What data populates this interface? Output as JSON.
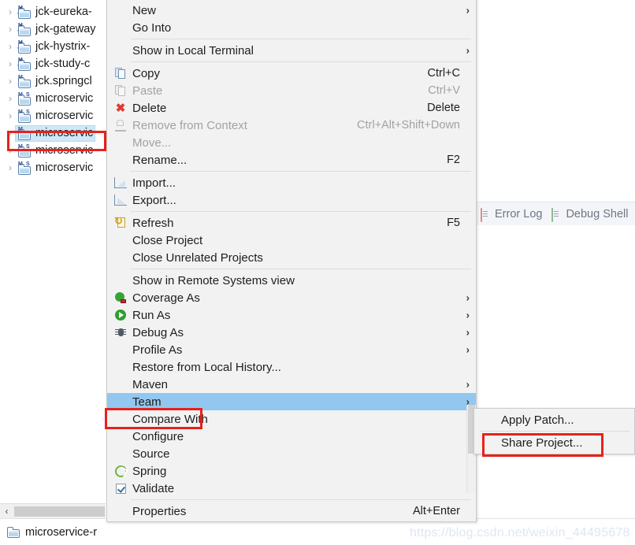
{
  "explorer": {
    "items": [
      {
        "label": "jck-eureka-",
        "badges": [
          "M",
          "J"
        ],
        "selected": false
      },
      {
        "label": "jck-gateway",
        "badges": [
          "M",
          "J"
        ],
        "selected": false
      },
      {
        "label": "jck-hystrix-",
        "badges": [
          "M",
          "J"
        ],
        "selected": false
      },
      {
        "label": "jck-study-c",
        "badges": [
          "M",
          "J"
        ],
        "selected": false
      },
      {
        "label": "jck.springcl",
        "badges": [
          "M"
        ],
        "selected": false
      },
      {
        "label": "microservic",
        "badges": [
          "M",
          "S"
        ],
        "selected": false
      },
      {
        "label": "microservic",
        "badges": [
          "M",
          "S"
        ],
        "selected": false
      },
      {
        "label": "microservic",
        "badges": [
          "M"
        ],
        "selected": true
      },
      {
        "label": "microservic",
        "badges": [
          "M",
          "S"
        ],
        "selected": false
      },
      {
        "label": "microservic",
        "badges": [
          "M",
          "S"
        ],
        "selected": false
      }
    ],
    "twisty": "›",
    "scrollbar": {
      "left_arrow": "‹"
    }
  },
  "statusbar": {
    "label": "microservice-r"
  },
  "view_tabs": [
    {
      "label": "Error Log",
      "icon": "error-log-icon"
    },
    {
      "label": "Debug Shell",
      "icon": "debug-shell-icon"
    }
  ],
  "context_menu": {
    "arrow": "›",
    "items": [
      {
        "type": "item",
        "label": "New",
        "accel": "",
        "icon": "",
        "submenu": true,
        "disabled": false
      },
      {
        "type": "item",
        "label": "Go Into",
        "accel": "",
        "icon": "",
        "submenu": false,
        "disabled": false
      },
      {
        "type": "separator"
      },
      {
        "type": "item",
        "label": "Show in Local Terminal",
        "accel": "",
        "icon": "",
        "submenu": true,
        "disabled": false
      },
      {
        "type": "separator"
      },
      {
        "type": "item",
        "label": "Copy",
        "accel": "Ctrl+C",
        "icon": "copy-icon",
        "submenu": false,
        "disabled": false
      },
      {
        "type": "item",
        "label": "Paste",
        "accel": "Ctrl+V",
        "icon": "paste-icon",
        "submenu": false,
        "disabled": true
      },
      {
        "type": "item",
        "label": "Delete",
        "accel": "Delete",
        "icon": "delete-icon",
        "submenu": false,
        "disabled": false
      },
      {
        "type": "item",
        "label": "Remove from Context",
        "accel": "Ctrl+Alt+Shift+Down",
        "icon": "remove-from-context-icon",
        "submenu": false,
        "disabled": true
      },
      {
        "type": "item",
        "label": "Move...",
        "accel": "",
        "icon": "",
        "submenu": false,
        "disabled": true
      },
      {
        "type": "item",
        "label": "Rename...",
        "accel": "F2",
        "icon": "",
        "submenu": false,
        "disabled": false
      },
      {
        "type": "separator"
      },
      {
        "type": "item",
        "label": "Import...",
        "accel": "",
        "icon": "import-icon",
        "submenu": false,
        "disabled": false
      },
      {
        "type": "item",
        "label": "Export...",
        "accel": "",
        "icon": "export-icon",
        "submenu": false,
        "disabled": false
      },
      {
        "type": "separator"
      },
      {
        "type": "item",
        "label": "Refresh",
        "accel": "F5",
        "icon": "refresh-icon",
        "submenu": false,
        "disabled": false
      },
      {
        "type": "item",
        "label": "Close Project",
        "accel": "",
        "icon": "",
        "submenu": false,
        "disabled": false
      },
      {
        "type": "item",
        "label": "Close Unrelated Projects",
        "accel": "",
        "icon": "",
        "submenu": false,
        "disabled": false
      },
      {
        "type": "separator"
      },
      {
        "type": "item",
        "label": "Show in Remote Systems view",
        "accel": "",
        "icon": "",
        "submenu": false,
        "disabled": false
      },
      {
        "type": "item",
        "label": "Coverage As",
        "accel": "",
        "icon": "coverage-icon",
        "submenu": true,
        "disabled": false
      },
      {
        "type": "item",
        "label": "Run As",
        "accel": "",
        "icon": "run-icon",
        "submenu": true,
        "disabled": false
      },
      {
        "type": "item",
        "label": "Debug As",
        "accel": "",
        "icon": "debug-icon",
        "submenu": true,
        "disabled": false
      },
      {
        "type": "item",
        "label": "Profile As",
        "accel": "",
        "icon": "",
        "submenu": true,
        "disabled": false
      },
      {
        "type": "item",
        "label": "Restore from Local History...",
        "accel": "",
        "icon": "",
        "submenu": false,
        "disabled": false
      },
      {
        "type": "item",
        "label": "Maven",
        "accel": "",
        "icon": "",
        "submenu": true,
        "disabled": false
      },
      {
        "type": "item",
        "label": "Team",
        "accel": "",
        "icon": "",
        "submenu": true,
        "disabled": false,
        "highlighted": true
      },
      {
        "type": "item",
        "label": "Compare With",
        "accel": "",
        "icon": "",
        "submenu": true,
        "disabled": false
      },
      {
        "type": "item",
        "label": "Configure",
        "accel": "",
        "icon": "",
        "submenu": true,
        "disabled": false
      },
      {
        "type": "item",
        "label": "Source",
        "accel": "",
        "icon": "",
        "submenu": true,
        "disabled": false
      },
      {
        "type": "item",
        "label": "Spring",
        "accel": "",
        "icon": "spring-icon",
        "submenu": true,
        "disabled": false
      },
      {
        "type": "item",
        "label": "Validate",
        "accel": "",
        "icon": "validate-icon",
        "submenu": false,
        "disabled": false
      },
      {
        "type": "separator"
      },
      {
        "type": "item",
        "label": "Properties",
        "accel": "Alt+Enter",
        "icon": "",
        "submenu": false,
        "disabled": false
      }
    ]
  },
  "submenu": {
    "items": [
      {
        "label": "Apply Patch...",
        "highlighted": false
      },
      {
        "label": "Share Project...",
        "highlighted": false
      }
    ]
  },
  "annotations": {
    "color": "#E8211A",
    "targets": [
      "selected-project",
      "team-menu-item",
      "share-project-menu-item"
    ]
  },
  "watermark": {
    "text": "https://blog.csdn.net/weixin_44495678"
  }
}
